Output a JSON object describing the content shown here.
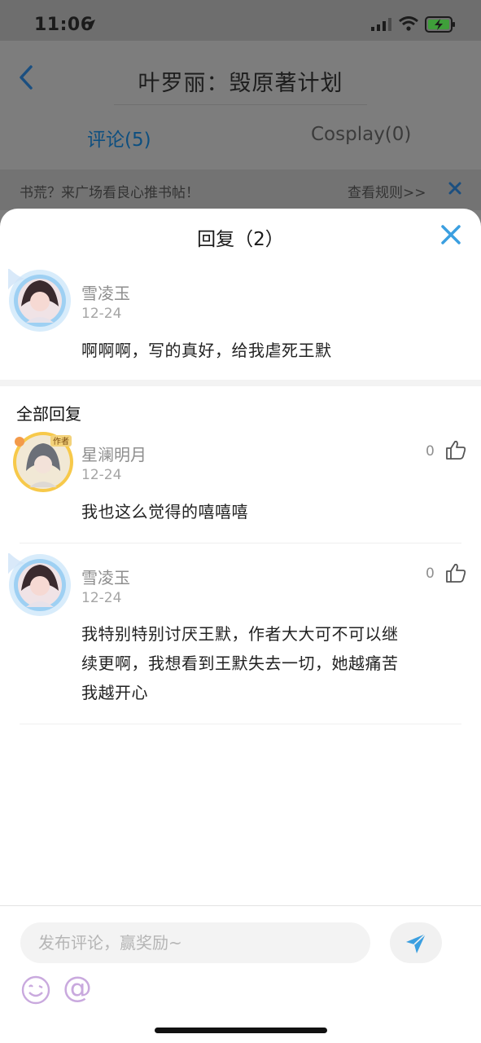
{
  "status_bar": {
    "time": "11:06"
  },
  "background_page": {
    "title": "叶罗丽：毁原著计划",
    "tabs": [
      {
        "label": "评论(5)"
      },
      {
        "label": "Cosplay(0)"
      }
    ],
    "banner": {
      "text": "书荒？来广场看良心推书帖！",
      "rules_link": "查看规则>>"
    }
  },
  "sheet": {
    "title": "回复（2）",
    "original_comment": {
      "user": "雪凌玉",
      "date": "12-24",
      "text": "啊啊啊，写的真好，给我虐死王默"
    },
    "section_title": "全部回复",
    "replies": [
      {
        "user": "星澜明月",
        "date": "12-24",
        "likes": "0",
        "text": "我也这么觉得的嘻嘻嘻",
        "avatar_badge": "作者"
      },
      {
        "user": "雪凌玉",
        "date": "12-24",
        "likes": "0",
        "text_lines": [
          "我特别特别讨厌王默，作者大大可不可以继",
          "续更啊，我想看到王默失去一切，她越痛苦",
          "我越开心"
        ]
      }
    ]
  },
  "input_bar": {
    "placeholder": "发布评论，赢奖励~",
    "at_symbol": "@"
  },
  "colors": {
    "accent_blue": "#3b9fe0",
    "overlay_gray": "#7d7d7d",
    "emoji_purple": "#c9a9de"
  },
  "icons": [
    "location-arrow-icon",
    "signal-icon",
    "wifi-icon",
    "battery-charging-icon",
    "back-chevron-icon",
    "close-icon",
    "thumbs-up-icon",
    "send-icon",
    "emoji-icon"
  ]
}
